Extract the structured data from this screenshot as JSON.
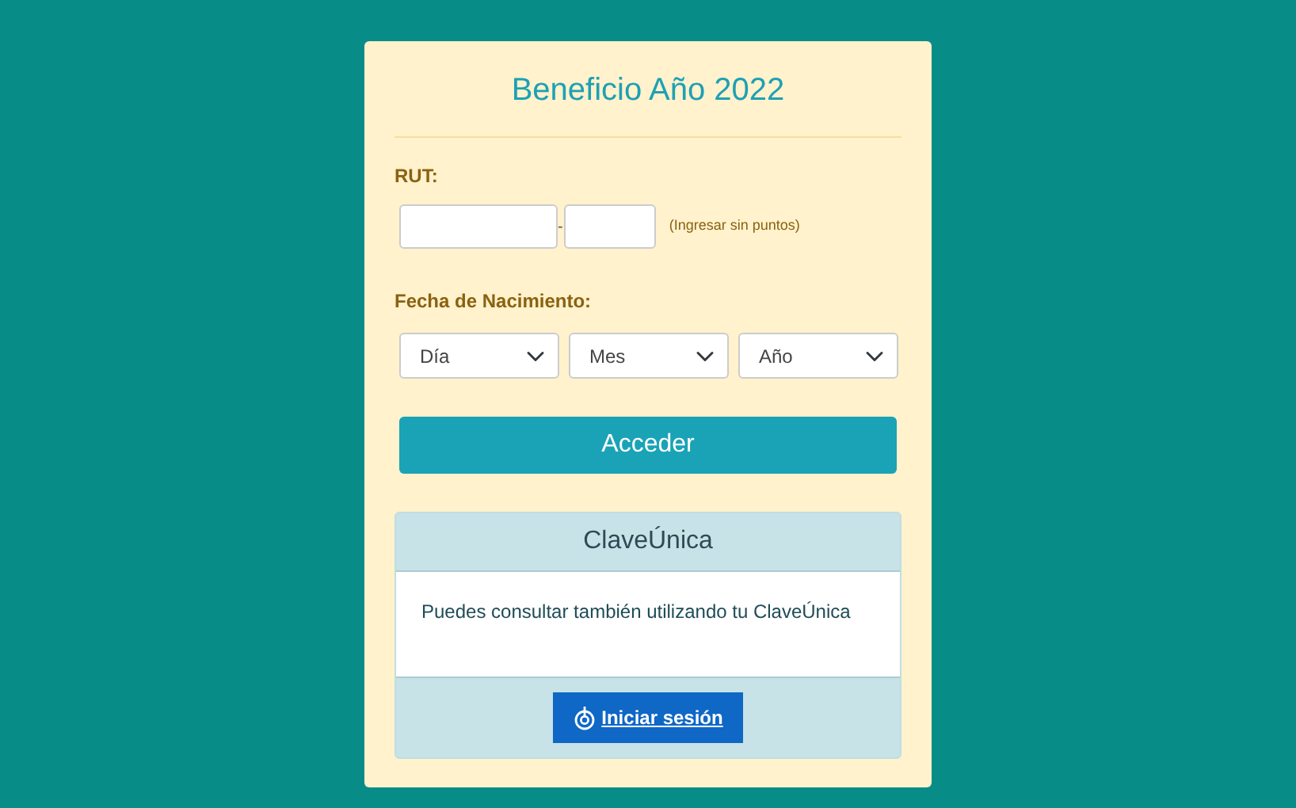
{
  "title": "Beneficio Año 2022",
  "rut": {
    "label": "RUT:",
    "separator": "-",
    "hint": "(Ingresar sin puntos)"
  },
  "birth_date": {
    "label": "Fecha de Nacimiento:",
    "selects": [
      {
        "value": "Día"
      },
      {
        "value": "Mes"
      },
      {
        "value": "Año"
      }
    ]
  },
  "submit_button": "Acceder",
  "clave_unica": {
    "header": "ClaveÚnica",
    "text": "Puedes consultar también utilizando tu ClaveÚnica",
    "button": "Iniciar sesión"
  }
}
